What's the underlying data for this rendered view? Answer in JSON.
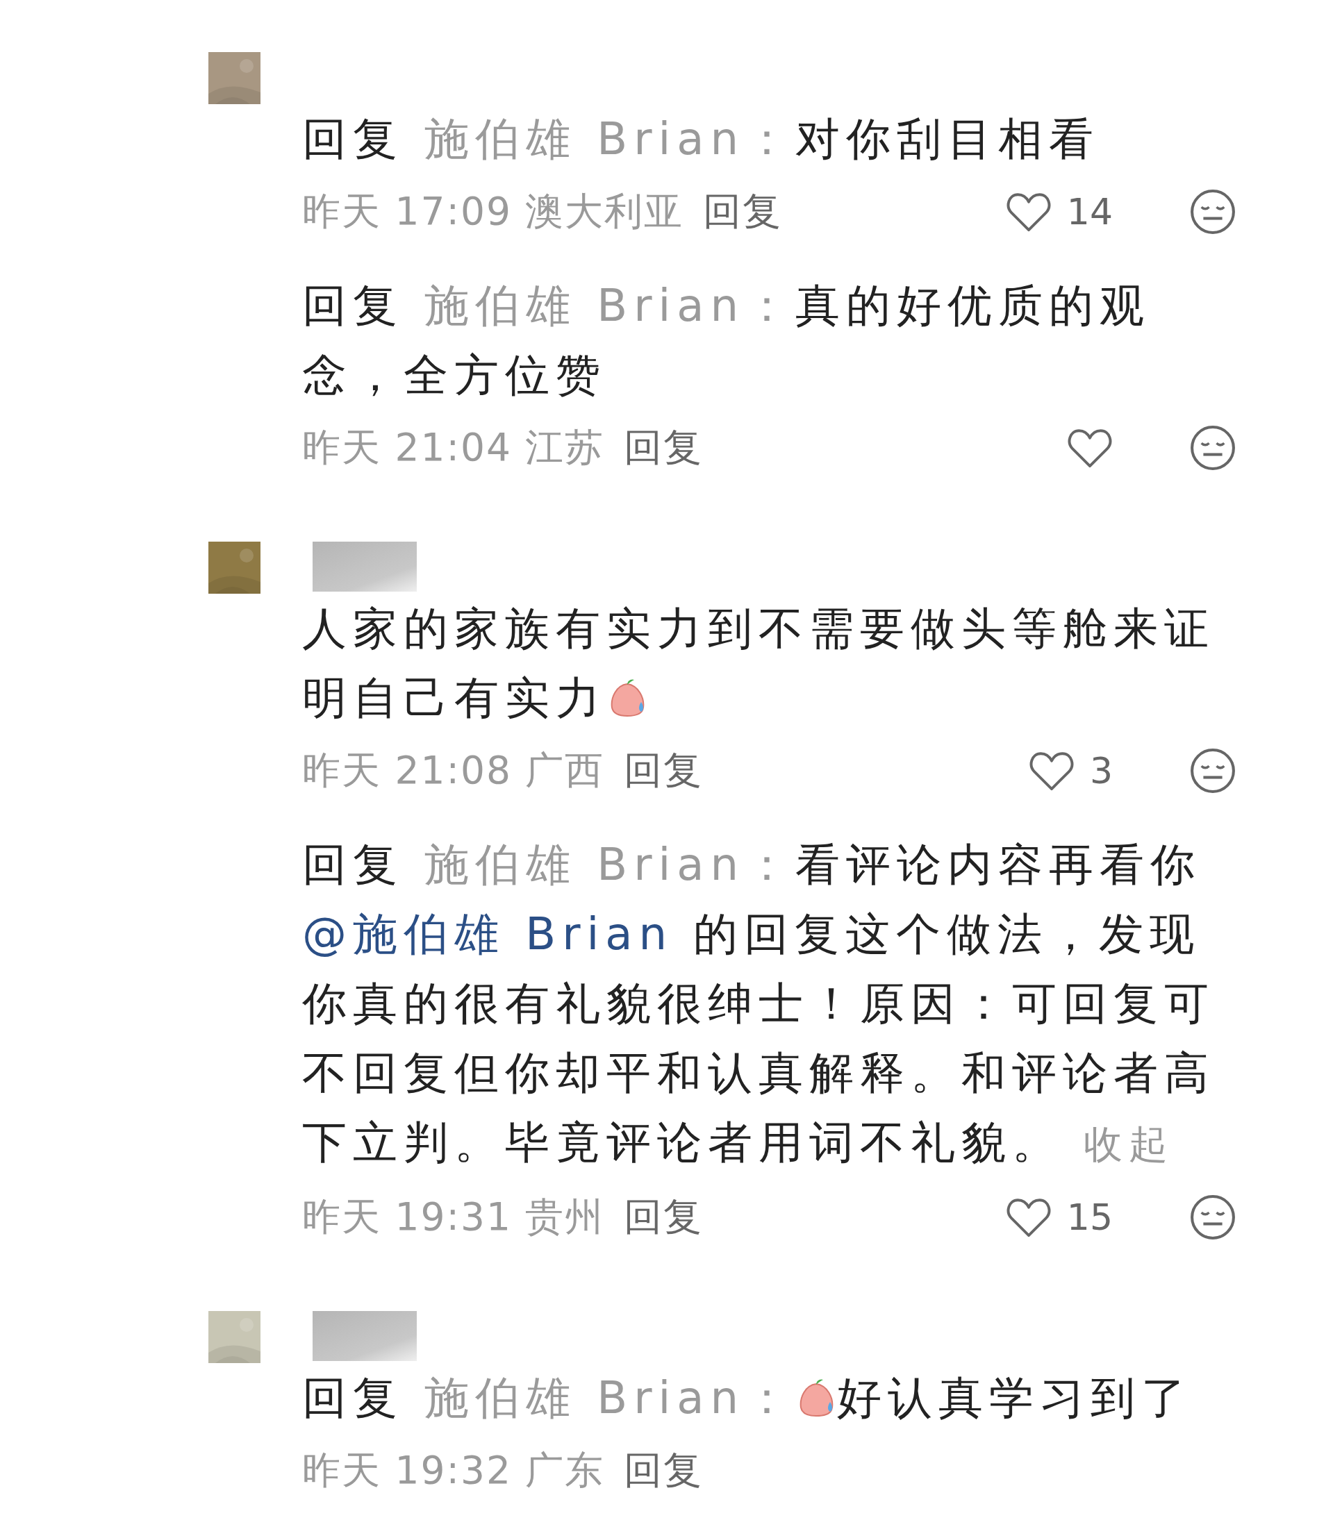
{
  "comments": [
    {
      "avatar": {
        "color": "#a89782"
      },
      "redacted": false,
      "reply_label": "回复",
      "reply_to": "施伯雄 Brian：",
      "segments": [
        {
          "kind": "text",
          "text": "对你刮目相看"
        }
      ],
      "meta": {
        "time": "昨天 17:09",
        "location": "澳大利亚",
        "reply": "回复",
        "likes": "14",
        "actions": true
      }
    },
    {
      "reply_label": "回复",
      "reply_to": "施伯雄 Brian：",
      "segments": [
        {
          "kind": "text",
          "text": "真的好优质的观念，全方位赞"
        }
      ],
      "meta": {
        "time": "昨天 21:04",
        "location": "江苏",
        "reply": "回复",
        "actions": true
      }
    },
    {
      "avatar": {
        "color": "#8f7a45"
      },
      "redacted": true,
      "segments": [
        {
          "kind": "text",
          "text": "人家的家族有实力到不需要做头等舱来证明自己有实力"
        },
        {
          "kind": "emoji"
        }
      ],
      "meta": {
        "time": "昨天 21:08",
        "location": "广西",
        "reply": "回复",
        "likes": "3",
        "actions": true
      }
    },
    {
      "reply_label": "回复",
      "reply_to": "施伯雄 Brian：",
      "segments": [
        {
          "kind": "text",
          "text": "看评论内容再看你"
        },
        {
          "kind": "mention",
          "text": "@施伯雄 Brian"
        },
        {
          "kind": "text",
          "text": " 的回复这个做法，发现你真的很有礼貌很绅士！原因：可回复可不回复但你却平和认真解释。和评论者高下立判。毕竟评论者用词不礼貌。"
        },
        {
          "kind": "collapse",
          "text": "收起"
        }
      ],
      "meta": {
        "time": "昨天 19:31",
        "location": "贵州",
        "reply": "回复",
        "likes": "15",
        "actions": true
      }
    },
    {
      "avatar": {
        "color": "#c8c6b4"
      },
      "redacted": true,
      "reply_label": "回复",
      "reply_to": "施伯雄 Brian：",
      "segments": [
        {
          "kind": "emoji"
        },
        {
          "kind": "text",
          "text": "好认真学习到了"
        }
      ],
      "meta": {
        "time": "昨天 19:32",
        "location": "广东",
        "reply": "回复",
        "actions": false
      }
    }
  ]
}
